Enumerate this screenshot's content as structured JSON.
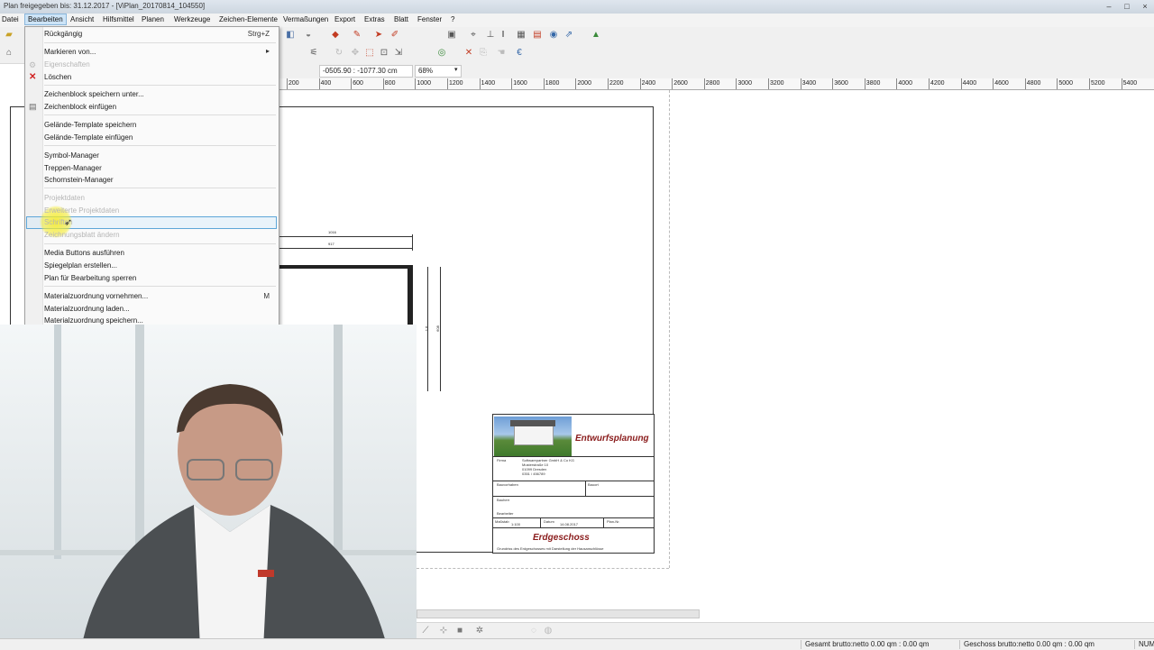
{
  "window": {
    "title": "Plan freigegeben bis: 31.12.2017 - [ViPlan_20170814_104550]",
    "controls": [
      "–",
      "□",
      "×"
    ]
  },
  "menubar": {
    "items": [
      "Datei",
      "Bearbeiten",
      "Ansicht",
      "Hilfsmittel",
      "Planen",
      "Werkzeuge",
      "Zeichen-Elemente",
      "Vermaßungen",
      "Export",
      "Extras",
      "Blatt",
      "Fenster",
      "?"
    ]
  },
  "coords": {
    "position": "-0505.90 : -1077.30 cm",
    "zoom": "68%"
  },
  "ruler": {
    "ticks": [
      "200",
      "400",
      "600",
      "800",
      "1000",
      "1200",
      "1400",
      "1600",
      "1800",
      "2000",
      "2200",
      "2400",
      "2600",
      "2800",
      "3000",
      "3200",
      "3400",
      "3600",
      "3800",
      "4000",
      "4200",
      "4400",
      "4600",
      "4800",
      "5000",
      "5200",
      "5400"
    ]
  },
  "dropdown": {
    "items": [
      {
        "label": "Rückgängig",
        "shortcut": "Strg+Z",
        "disabled": false
      },
      {
        "label": "Markieren von...",
        "shortcut": "▸",
        "disabled": false
      },
      {
        "label": "Eigenschaften",
        "shortcut": "",
        "disabled": true
      },
      {
        "label": "Löschen",
        "shortcut": "",
        "disabled": false
      },
      {
        "label": "Zeichenblock speichern unter...",
        "shortcut": "",
        "disabled": false
      },
      {
        "label": "Zeichenblock einfügen",
        "shortcut": "",
        "disabled": false
      },
      {
        "label": "Gelände-Template speichern",
        "shortcut": "",
        "disabled": false
      },
      {
        "label": "Gelände-Template einfügen",
        "shortcut": "",
        "disabled": false
      },
      {
        "label": "Symbol-Manager",
        "shortcut": "",
        "disabled": false
      },
      {
        "label": "Treppen-Manager",
        "shortcut": "",
        "disabled": false
      },
      {
        "label": "Schornstein-Manager",
        "shortcut": "",
        "disabled": false
      },
      {
        "label": "Projektdaten",
        "shortcut": "",
        "disabled": true
      },
      {
        "label": "Erweiterte Projektdaten",
        "shortcut": "",
        "disabled": true
      },
      {
        "label": "Schriften",
        "shortcut": "",
        "disabled": true
      },
      {
        "label": "Zeichnungsblatt ändern",
        "shortcut": "",
        "disabled": true
      },
      {
        "label": "Media Buttons ausführen",
        "shortcut": "",
        "disabled": false
      },
      {
        "label": "Spiegelplan erstellen...",
        "shortcut": "",
        "disabled": false
      },
      {
        "label": "Plan für Bearbeitung sperren",
        "shortcut": "",
        "disabled": false
      },
      {
        "label": "Materialzuordnung vornehmen...",
        "shortcut": "M",
        "disabled": false
      },
      {
        "label": "Materialzuordnung laden...",
        "shortcut": "",
        "disabled": false
      },
      {
        "label": "Materialzuordnung speichern...",
        "shortcut": "",
        "disabled": false
      }
    ]
  },
  "drawing": {
    "dim_top_1": "1016",
    "dim_top_2": "917",
    "dim_right_1": "1.6",
    "dim_right_2": "608"
  },
  "titleblock": {
    "heading": "Entwurfsplanung",
    "firma_label": "Firma",
    "firma_lines": [
      "Softwarepartner GmbH & Co KG",
      "Musterstraße 10",
      "01099 Dresden",
      "0351 / 456789"
    ],
    "bauvorhaben_label": "Bauvorhaben",
    "bauort_label": "Bauort",
    "bauherr_label": "Bauherr",
    "bearbeiter_label": "Bearbeiter",
    "row_labels": [
      "Maßstab",
      "Datum",
      "Plan-Nr."
    ],
    "massstab": "1:100",
    "datum": "14.08.2017",
    "floor": "Erdgeschoss",
    "footnote": "Grundriss des Erdgeschosses mit Darstellung der Hausanschlüsse"
  },
  "statusbar": {
    "gesamt": "Gesamt brutto:netto 0.00 qm : 0.00 qm",
    "geschoss": "Geschoss brutto:netto 0.00 qm : 0.00 qm",
    "num": "NUM"
  },
  "colors": {
    "accent_red": "#8a1c1c",
    "menu_highlight": "#cde4f7",
    "cursor_highlight": "#f2e600"
  }
}
